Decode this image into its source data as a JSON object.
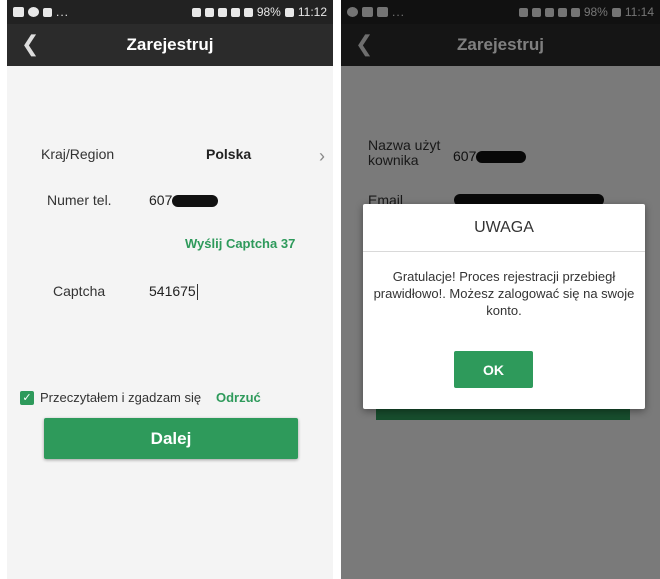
{
  "left": {
    "status": {
      "time": "11:12",
      "battery": "98%",
      "overflow": "..."
    },
    "title": "Zarejestruj",
    "country_label": "Kraj/Region",
    "country_value": "Polska",
    "phone_label": "Numer tel.",
    "phone_value": "607",
    "captcha_link": "Wyślij Captcha 37",
    "captcha_label": "Captcha",
    "captcha_value": "541675",
    "agree_text": "Przeczytałem i zgadzam się",
    "reject_link": "Odrzuć",
    "next_button": "Dalej"
  },
  "right": {
    "status": {
      "time": "11:14",
      "battery": "98%",
      "overflow": "..."
    },
    "title": "Zarejestruj",
    "username_label": "Nazwa użyt kownika",
    "username_value": "607",
    "email_label": "Email",
    "dialog": {
      "title": "UWAGA",
      "message": "Gratulacje! Proces rejestracji przebiegł prawidłowo!. Możesz zalogować się na swoje konto.",
      "ok": "OK"
    }
  },
  "colors": {
    "accent": "#2e9a5b",
    "appbar": "#2b2b2b",
    "statusbar": "#222222"
  }
}
